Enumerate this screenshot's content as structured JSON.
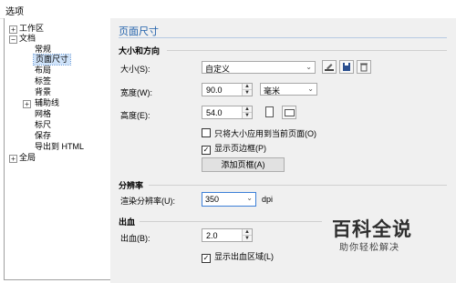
{
  "window": {
    "title": "选项"
  },
  "tree": {
    "workspace": "工作区",
    "document": "文档",
    "items": [
      "常规",
      "页面尺寸",
      "布局",
      "标签",
      "背景",
      "辅助线",
      "网格",
      "标尺",
      "保存",
      "导出到 HTML"
    ],
    "global": "全局"
  },
  "panel": {
    "title": "页面尺寸",
    "size_section": "大小和方向",
    "size_label": "大小(S):",
    "size_value": "自定义",
    "width_label": "宽度(W):",
    "width_value": "90.0",
    "unit_value": "毫米",
    "height_label": "高度(E):",
    "height_value": "54.0",
    "apply_current_only": "只将大小应用到当前页面(O)",
    "apply_current_only_checked": false,
    "show_page_border": "显示页边框(P)",
    "show_page_border_checked": true,
    "add_page_frame": "添加页框(A)",
    "resolution_section": "分辨率",
    "render_res_label": "渲染分辨率(U):",
    "render_res_value": "350",
    "render_res_unit": "dpi",
    "bleed_section": "出血",
    "bleed_label": "出血(B):",
    "bleed_value": "2.0",
    "show_bleed": "显示出血区域(L)",
    "show_bleed_checked": true
  },
  "watermark": {
    "main": "百科全说",
    "sub": "助你轻松解决"
  }
}
